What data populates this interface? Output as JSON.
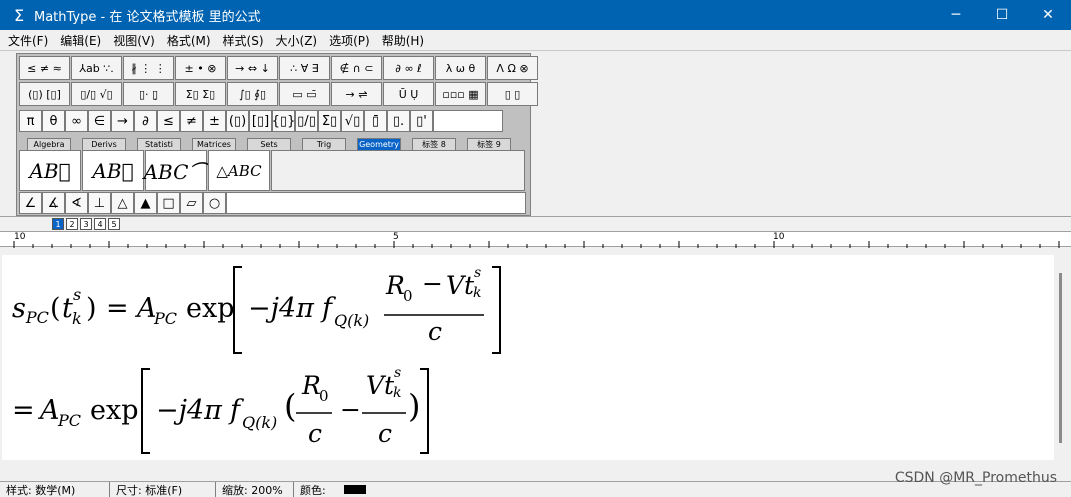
{
  "window": {
    "app_icon": "Σ",
    "title": "MathType - 在 论文格式模板 里的公式",
    "minimize": "─",
    "maximize": "☐",
    "close": "✕"
  },
  "menu": [
    "文件(F)",
    "编辑(E)",
    "视图(V)",
    "格式(M)",
    "样式(S)",
    "大小(Z)",
    "选项(P)",
    "帮助(H)"
  ],
  "toolbar": {
    "row1": [
      "≤ ≠ ≈",
      "⅄ab ∵.",
      "∦ ⋮ ⋮",
      "± • ⊗",
      "→ ⇔ ↓",
      "∴ ∀ ∃",
      "∉ ∩ ⊂",
      "∂ ∞ ℓ",
      "λ ω θ",
      "Λ Ω ⊗"
    ],
    "row2": [
      "(▯) [▯]",
      "▯/▯ √▯",
      "▯· ▯̣",
      "Σ▯ Σ▯",
      "∫▯ ∮▯",
      "▭ ▭̄",
      "→ ⇌",
      "Ū Ụ",
      "▫▫▫ ▦",
      "▯ ▯"
    ],
    "row3": [
      "π",
      "θ",
      "∞",
      "∈",
      "→",
      "∂",
      "≤",
      "≠",
      "±",
      "(▯)",
      "[▯]",
      "{▯}",
      "▯/▯",
      "Σ▯",
      "√▯",
      "▯̄",
      "▯.",
      "▯'"
    ],
    "tabs": [
      "Algebra",
      "Derivs",
      "Statisti",
      "Matrices",
      "Sets",
      "Trig",
      "Geometry",
      "标签 8",
      "标签 9"
    ],
    "templates": [
      "AB⃗",
      "AB⃡",
      "ABC⌒",
      "△ABC"
    ],
    "row5": [
      "∠",
      "∡",
      "∢",
      "⊥",
      "△",
      "▲",
      "□",
      "▱",
      "○"
    ],
    "size_buttons": [
      "1",
      "2",
      "3",
      "4",
      "5"
    ]
  },
  "ruler": {
    "labels": [
      "10",
      "5",
      "10"
    ]
  },
  "equation": {
    "line1_lhs_s": "s",
    "line1_lhs_sub": "PC",
    "line1_t": "t",
    "line1_t_sup": "s",
    "line1_t_sub": "k",
    "eq_sign": "=",
    "A": "A",
    "A_sub": "PC",
    "exp": "exp",
    "minus_j4pi": "−j4π",
    "f": "f",
    "f_sub": "Q(k)",
    "R": "R",
    "R_sub": "0",
    "minus": "−",
    "Vt": "Vt",
    "Vt_sup": "s",
    "Vt_sub": "k",
    "c": "c",
    "lparen": "(",
    "rparen": ")"
  },
  "status": {
    "style": "样式: 数学(M)",
    "size": "尺寸: 标准(F)",
    "zoom": "缩放: 200%",
    "color": "颜色:"
  },
  "watermark": "CSDN @MR_Promethus",
  "colors": {
    "title_bar": "#0063b1",
    "active_tab": "#0a64c8"
  }
}
